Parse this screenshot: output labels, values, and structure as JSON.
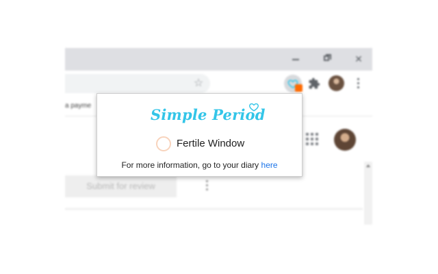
{
  "browser": {
    "bookmark_text": "a payme",
    "submit_button_label": "Submit for review"
  },
  "popup": {
    "logo_text": "Simple Period",
    "status_label": "Fertile Window",
    "info_prefix": "For more information, go to your diary ",
    "info_link": "here"
  },
  "colors": {
    "brand": "#33c5e8",
    "fertile_ring": "#f8d3bc",
    "link": "#1a73e8",
    "badge": "#ff6a00"
  },
  "icons": {
    "extension": "heart-icon",
    "logo": "heart-icon",
    "puzzle": "extensions-puzzle-icon",
    "bookmark": "star-icon",
    "menu": "more-vert-icon",
    "apps": "apps-grid-icon"
  }
}
